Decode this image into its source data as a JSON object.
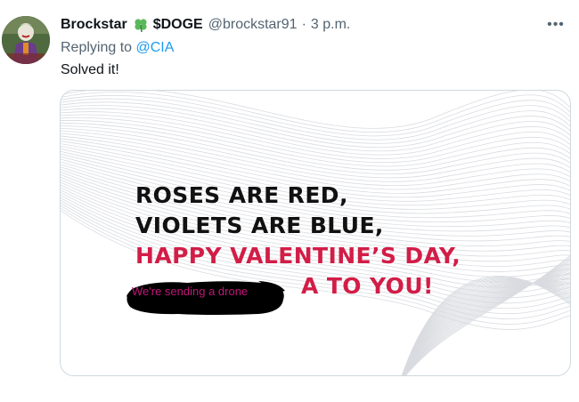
{
  "tweet": {
    "author_name": "Brockstar",
    "author_badge": "$DOGE",
    "handle": "@brockstar91",
    "separator": "·",
    "time": "3 p.m.",
    "more_icon": "•••",
    "replying_prefix": "Replying to",
    "replying_to": "@CIA",
    "text": "Solved it!"
  },
  "media": {
    "line1": "ROSES ARE RED,",
    "line2": "VIOLETS ARE BLUE,",
    "line3": "HAPPY VALENTINE’S DAY,",
    "line4_end": "A TO YOU!",
    "overlay_text": "We're sending a drone",
    "colors": {
      "text_black": "#111111",
      "text_red": "#d21d47",
      "overlay_text": "#c2177a",
      "blot": "#000000"
    }
  },
  "icons": [
    "avatar",
    "clover-icon",
    "more-icon"
  ]
}
